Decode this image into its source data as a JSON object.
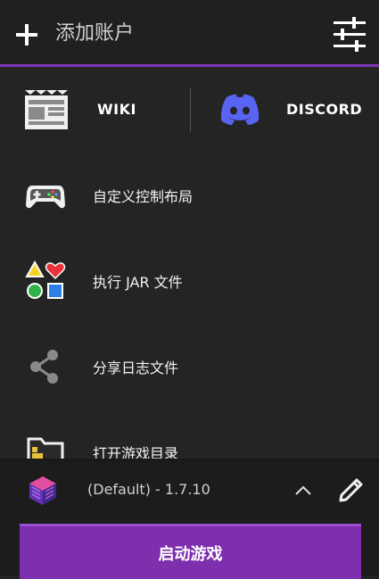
{
  "header": {
    "title": "添加账户",
    "add_icon": "plus-icon",
    "settings_icon": "sliders-icon",
    "accent": "#7b35b8"
  },
  "links": {
    "wiki_label": "WIKI",
    "discord_label": "DISCORD"
  },
  "menu": {
    "items": [
      {
        "label": "自定义控制布局",
        "icon": "gamepad-icon"
      },
      {
        "label": "执行 JAR 文件",
        "icon": "shapes-icon"
      },
      {
        "label": "分享日志文件",
        "icon": "share-icon"
      },
      {
        "label": "打开游戏目录",
        "icon": "folder-icon"
      }
    ]
  },
  "bottom": {
    "profile_version": "(Default) - 1.7.10",
    "launch_label": "启动游戏",
    "launch_color": "#7e2fae"
  }
}
